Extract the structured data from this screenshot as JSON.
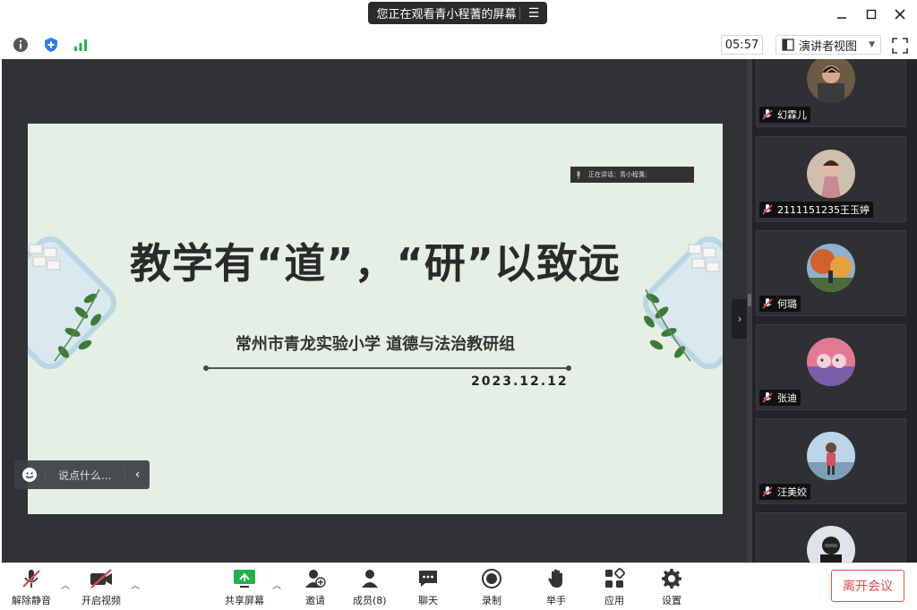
{
  "titlebar": {
    "sharing_text": "您正在观看青小程蓍的屏幕",
    "menu_icon": "list-icon"
  },
  "toolbar": {
    "timer": "05:57",
    "view_mode": "演讲者视图"
  },
  "slide": {
    "title": "教学有“道”，“研”以致远",
    "subtitle": "常州市青龙实验小学  道德与法治教研组",
    "date": "2023.12.12",
    "speaking_label": "正在讲话：青小程蓍;"
  },
  "chat": {
    "placeholder": "说点什么..."
  },
  "participants": [
    {
      "name": "幻霖儿",
      "muted": true
    },
    {
      "name": "2111151235王玉婷",
      "muted": true
    },
    {
      "name": "何璐",
      "muted": true
    },
    {
      "name": "张迪",
      "muted": true
    },
    {
      "name": "汪美姣",
      "muted": true
    },
    {
      "name": "",
      "muted": true
    }
  ],
  "bottombar": {
    "unmute": "解除静音",
    "start_video": "开启视频",
    "share_screen": "共享屏幕",
    "invite": "邀请",
    "members": "成员(8)",
    "chat": "聊天",
    "record": "录制",
    "raise_hand": "举手",
    "apps": "应用",
    "settings": "设置",
    "leave": "离开会议"
  },
  "colors": {
    "accent_green": "#22b24c",
    "danger_red": "#e24b4b",
    "slide_bg": "#e6efe6",
    "dark_bg": "#303236"
  }
}
